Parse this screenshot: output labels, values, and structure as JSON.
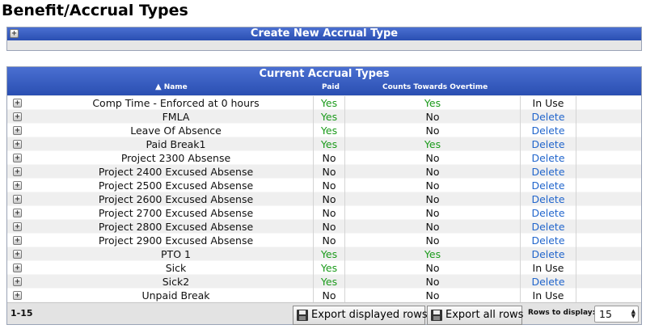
{
  "page": {
    "title": "Benefit/Accrual Types"
  },
  "create_panel": {
    "title": "Create New Accrual Type"
  },
  "grid": {
    "title": "Current Accrual Types",
    "columns": {
      "name": "Name",
      "paid": "Paid",
      "overtime": "Counts Towards Overtime"
    },
    "sort_indicator": "▲",
    "rows": [
      {
        "name": "Comp Time - Enforced at 0 hours",
        "paid": "Yes",
        "overtime": "Yes",
        "action": "In Use"
      },
      {
        "name": "FMLA",
        "paid": "Yes",
        "overtime": "No",
        "action": "Delete"
      },
      {
        "name": "Leave Of Absence",
        "paid": "Yes",
        "overtime": "No",
        "action": "Delete"
      },
      {
        "name": "Paid Break1",
        "paid": "Yes",
        "overtime": "Yes",
        "action": "Delete"
      },
      {
        "name": "Project 2300 Absense",
        "paid": "No",
        "overtime": "No",
        "action": "Delete"
      },
      {
        "name": "Project 2400 Excused Absense",
        "paid": "No",
        "overtime": "No",
        "action": "Delete"
      },
      {
        "name": "Project 2500 Excused Absense",
        "paid": "No",
        "overtime": "No",
        "action": "Delete"
      },
      {
        "name": "Project 2600 Excused Absense",
        "paid": "No",
        "overtime": "No",
        "action": "Delete"
      },
      {
        "name": "Project 2700 Excused Absense",
        "paid": "No",
        "overtime": "No",
        "action": "Delete"
      },
      {
        "name": "Project 2800 Excused Absense",
        "paid": "No",
        "overtime": "No",
        "action": "Delete"
      },
      {
        "name": "Project 2900 Excused Absense",
        "paid": "No",
        "overtime": "No",
        "action": "Delete"
      },
      {
        "name": "PTO 1",
        "paid": "Yes",
        "overtime": "Yes",
        "action": "Delete"
      },
      {
        "name": "Sick",
        "paid": "Yes",
        "overtime": "No",
        "action": "In Use"
      },
      {
        "name": "Sick2",
        "paid": "Yes",
        "overtime": "No",
        "action": "Delete"
      },
      {
        "name": "Unpaid Break",
        "paid": "No",
        "overtime": "No",
        "action": "In Use"
      }
    ]
  },
  "footer": {
    "range": "1-15",
    "export_displayed_label": "Export displayed rows",
    "export_all_label": "Export all rows",
    "rows_to_display_label": "Rows to display:",
    "rows_to_display_value": "15"
  },
  "colors": {
    "header_blue": "#2a4fb2",
    "yes_green": "#1a9a1a",
    "delete_link": "#2266cc"
  }
}
